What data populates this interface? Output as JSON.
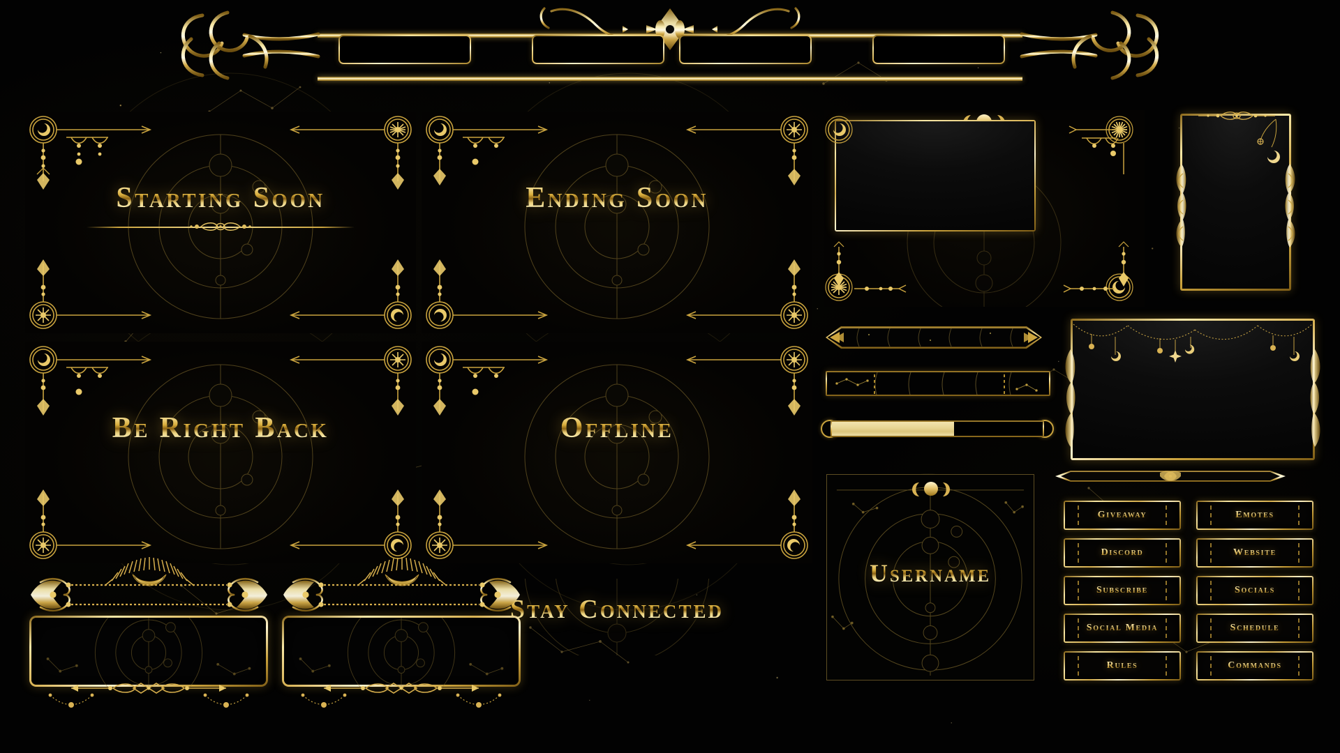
{
  "meta": {
    "pack_title": "Celestial Gold Stream Overlay Pack",
    "accent_gold": "#d8b253",
    "accent_gold_light": "#fdf4cf",
    "accent_gold_dark": "#7e5d16",
    "background": "#020202",
    "progress_fill": "#e6d493"
  },
  "topbar": {
    "name": "decorative-top-banner",
    "slots": [
      {
        "label": ""
      },
      {
        "label": ""
      },
      {
        "label": ""
      },
      {
        "label": ""
      }
    ],
    "center_ornament": "art-nouveau-medallion",
    "left_flourish": "scroll-flourish-left",
    "right_flourish": "scroll-flourish-right"
  },
  "scenes": [
    {
      "id": "starting-soon",
      "title": "Starting Soon",
      "has_divider": true,
      "corner_icons": [
        "crescent-moon-icon",
        "sunburst-icon",
        "sunburst-icon",
        "crescent-moon-icon"
      ]
    },
    {
      "id": "ending-soon",
      "title": "Ending Soon",
      "has_divider": false,
      "corner_icons": [
        "crescent-moon-icon",
        "sunburst-icon",
        "crescent-moon-icon",
        "sunburst-icon"
      ]
    },
    {
      "id": "be-right-back",
      "title": "Be Right Back",
      "has_divider": false,
      "corner_icons": [
        "crescent-moon-icon",
        "sunburst-icon",
        "sunburst-icon",
        "crescent-moon-icon"
      ]
    },
    {
      "id": "offline",
      "title": "Offline",
      "has_divider": false,
      "corner_icons": [
        "crescent-moon-icon",
        "sunburst-icon",
        "crescent-moon-icon",
        "sunburst-icon"
      ]
    }
  ],
  "stay_connected": {
    "title": "Stay Connected"
  },
  "username_panel": {
    "title": "Username",
    "top_icon": "triple-moon-icon"
  },
  "frames": [
    {
      "id": "webcam-frame-landscape",
      "label": "",
      "decor": "moon-phase-crown"
    },
    {
      "id": "webcam-frame-portrait",
      "label": "",
      "decor": "ornate-side-flourish"
    },
    {
      "id": "stream-frame-large",
      "label": "",
      "decor": "hanging-garland"
    }
  ],
  "bars": {
    "hex_bar": {
      "name": "alert-bar-hex",
      "label": ""
    },
    "rect_bar": {
      "name": "alert-bar-rect",
      "label": ""
    },
    "progress": {
      "name": "goal-progress-bar",
      "percent": 58,
      "label": ""
    },
    "pencil_bar": {
      "name": "divider-bar-tapered",
      "label": ""
    }
  },
  "banners": [
    {
      "id": "banner-left",
      "label": "",
      "crown": "sunburst-crescent-crown"
    },
    {
      "id": "banner-right",
      "label": "",
      "crown": "sunburst-crescent-crown"
    }
  ],
  "buttons": {
    "name": "panel-buttons",
    "rows": [
      {
        "left": "Giveaway",
        "right": "Emotes"
      },
      {
        "left": "Discord",
        "right": "Website"
      },
      {
        "left": "Subscribe",
        "right": "Socials"
      },
      {
        "left": "Social Media",
        "right": "Schedule"
      },
      {
        "left": "Rules",
        "right": "Commands"
      }
    ]
  }
}
